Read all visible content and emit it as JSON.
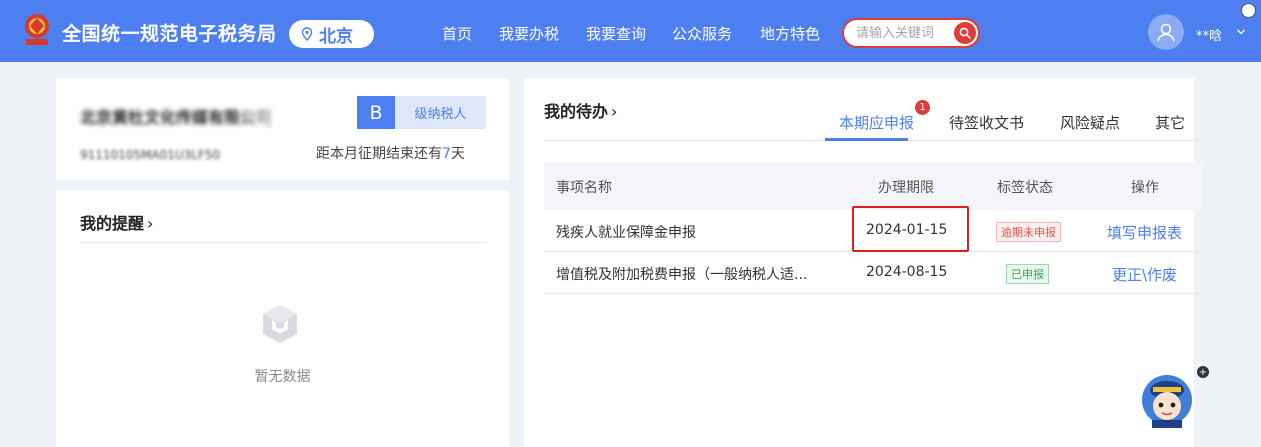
{
  "header": {
    "site_title": "全国统一规范电子税务局",
    "city": "北京",
    "nav": [
      "首页",
      "我要办税",
      "我要查询",
      "公众服务",
      "地方特色"
    ],
    "search_placeholder": "请输入关键词",
    "user_name": "**晗"
  },
  "company": {
    "name": "北京黄杜文化传媒有限公司",
    "level_letter": "B",
    "level_text": "级纳税人",
    "tax_id": "91110105MA01U3LF50",
    "deadline_prefix": "距本月征期结束还有",
    "deadline_days": "7",
    "deadline_suffix": "天"
  },
  "reminder": {
    "title": "我的提醒",
    "empty_text": "暂无数据"
  },
  "todo": {
    "title": "我的待办",
    "tabs": [
      "本期应申报",
      "待签收文书",
      "风险疑点",
      "其它"
    ],
    "active_tab_badge": "1",
    "columns": [
      "事项名称",
      "办理期限",
      "标签状态",
      "操作"
    ],
    "rows": [
      {
        "name": "残疾人就业保障金申报",
        "deadline": "2024-01-15",
        "status": "逾期未申报",
        "status_type": "overdue",
        "action": "填写申报表"
      },
      {
        "name": "增值税及附加税费申报（一般纳税人适...",
        "deadline": "2024-08-15",
        "status": "已申报",
        "status_type": "done",
        "action": "更正\\作废"
      }
    ]
  },
  "colors": {
    "brand_blue": "#4d7ff0",
    "alert_red": "#e03a3a",
    "done_green": "#3aa55a"
  },
  "icons": {
    "emblem": "tax-emblem-icon",
    "location": "location-pin-icon",
    "search": "search-icon",
    "avatar": "user-avatar-icon",
    "empty": "empty-box-icon",
    "mascot": "mascot-assistant-icon"
  }
}
